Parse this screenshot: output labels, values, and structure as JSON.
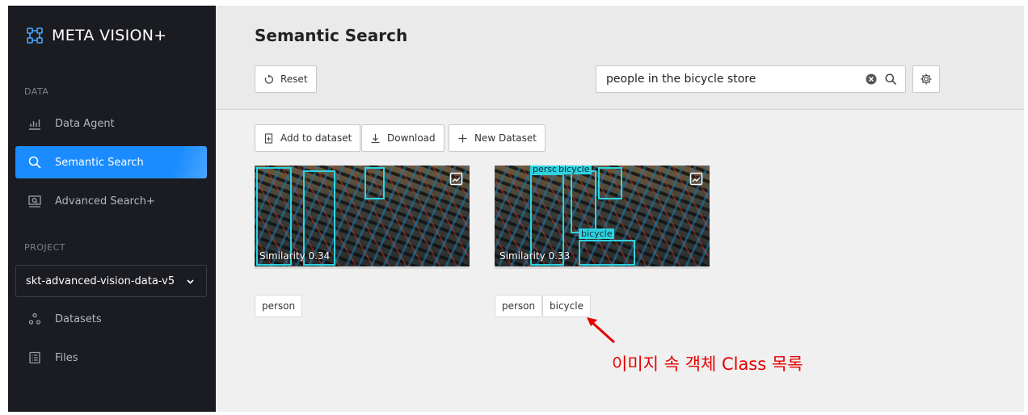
{
  "app": {
    "name": "META VISION+"
  },
  "sidebar": {
    "data_section": "DATA",
    "data_items": [
      {
        "label": "Data Agent",
        "icon": "bar-chart-icon"
      },
      {
        "label": "Semantic Search",
        "icon": "search-icon",
        "active": true
      },
      {
        "label": "Advanced Search+",
        "icon": "monitor-search-icon"
      }
    ],
    "project_section": "PROJECT",
    "project_select": "skt-advanced-vision-data-v5",
    "project_items": [
      {
        "label": "Datasets",
        "icon": "datasets-icon"
      },
      {
        "label": "Files",
        "icon": "files-icon"
      }
    ]
  },
  "header": {
    "title": "Semantic Search",
    "reset_label": "Reset",
    "search_value": "people in the bicycle store"
  },
  "toolbar": {
    "add_label": "Add to dataset",
    "download_label": "Download",
    "new_dataset_label": "New Dataset"
  },
  "results": [
    {
      "similarity": "Similarity 0.34",
      "tags": [
        "person"
      ],
      "box_labels": []
    },
    {
      "similarity": "Similarity 0.33",
      "tags": [
        "person",
        "bicycle"
      ],
      "box_labels": [
        "perso",
        "bicycle",
        "bicycle"
      ]
    }
  ],
  "annotation": {
    "text": "이미지 속 객체 Class 목록"
  },
  "colors": {
    "accent": "#1a8cff",
    "sidebar_bg": "#1b1c22",
    "bbox": "#2fd3e0",
    "annotation": "#e60000"
  }
}
